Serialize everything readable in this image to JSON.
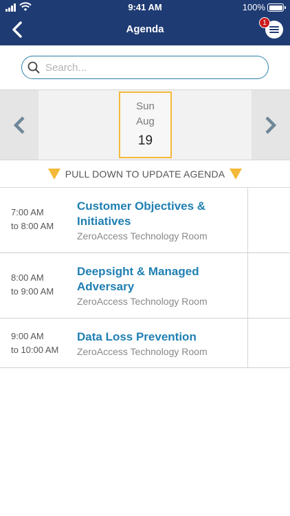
{
  "status_bar": {
    "time": "9:41 AM",
    "battery": "100%"
  },
  "nav": {
    "title": "Agenda",
    "menu_badge": "1"
  },
  "search": {
    "placeholder": "Search...",
    "value": ""
  },
  "date_selector": {
    "day_of_week": "Sun",
    "month": "Aug",
    "day": "19"
  },
  "pull_hint": "PULL DOWN TO UPDATE AGENDA",
  "agenda": [
    {
      "start": "7:00 AM",
      "end": "to 8:00 AM",
      "title": "Customer Objectives & Initiatives",
      "room": "ZeroAccess Technology Room"
    },
    {
      "start": "8:00 AM",
      "end": "to 9:00 AM",
      "title": "Deepsight & Managed Adversary",
      "room": "ZeroAccess Technology Room"
    },
    {
      "start": "9:00 AM",
      "end": "to 10:00 AM",
      "title": "Data Loss Prevention",
      "room": "ZeroAccess Technology Room"
    }
  ],
  "colors": {
    "header": "#1f3b73",
    "accent": "#1f7fb2",
    "highlight": "#f4b938",
    "badge": "#cc1c1c"
  },
  "icons": [
    "signal-icon",
    "wifi-icon",
    "battery-icon",
    "back-chevron-icon",
    "hamburger-menu-icon",
    "search-icon",
    "chevron-left-icon",
    "chevron-right-icon",
    "triangle-down-icon"
  ]
}
